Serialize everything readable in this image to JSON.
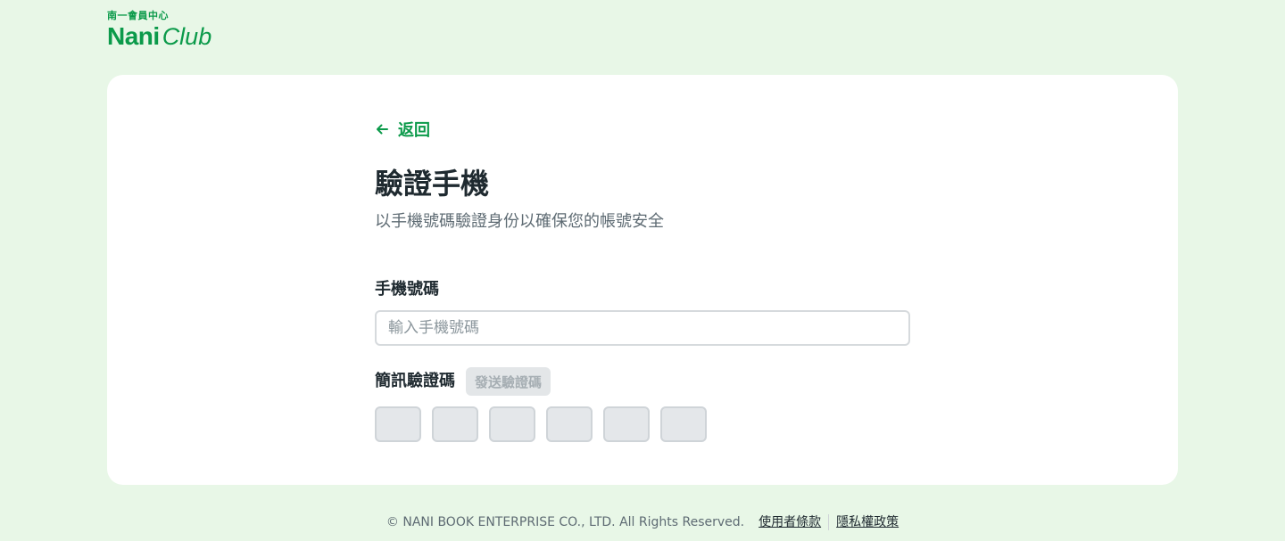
{
  "logo": {
    "subtitle": "南一會員中心",
    "brand_nani": "Nani",
    "brand_club": "Club"
  },
  "back": {
    "label": "返回"
  },
  "page": {
    "title": "驗證手機",
    "subtitle": "以手機號碼驗證身份以確保您的帳號安全"
  },
  "phone": {
    "label": "手機號碼",
    "placeholder": "輸入手機號碼",
    "value": ""
  },
  "sms": {
    "label": "簡訊驗證碼",
    "send_button": "發送驗證碼",
    "code_length": 6
  },
  "footer": {
    "copyright": "© NANI BOOK ENTERPRISE CO., LTD. All Rights Reserved.",
    "terms": "使用者條款",
    "privacy": "隱私權政策"
  },
  "colors": {
    "brand": "#0b9a4a",
    "background": "#e8f7e7",
    "card": "#ffffff"
  }
}
